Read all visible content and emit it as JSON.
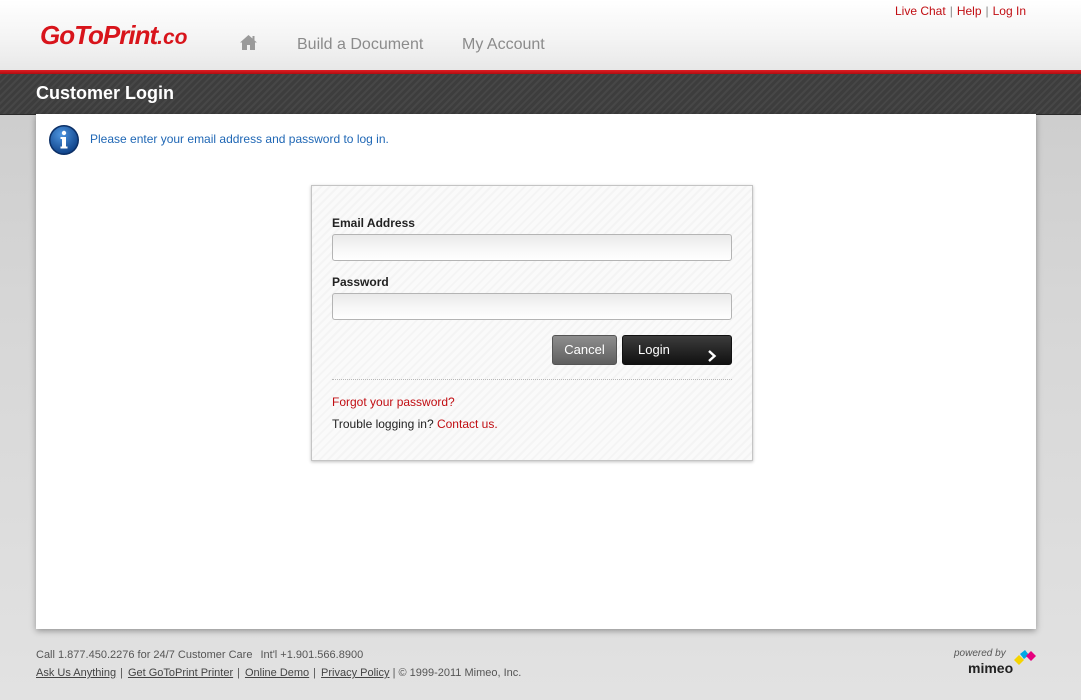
{
  "header": {
    "logo": {
      "main": "GoToPrint",
      "tld": ".co"
    },
    "home_icon": "home-icon",
    "nav": [
      {
        "label": "Build a Document"
      },
      {
        "label": "My Account"
      }
    ],
    "util_links": [
      {
        "label": "Live Chat"
      },
      {
        "label": "Help"
      },
      {
        "label": "Log In"
      }
    ],
    "util_separator": "|"
  },
  "page": {
    "title": "Customer Login",
    "info_icon": "info-icon",
    "info_message": "Please enter your email address and password to log in."
  },
  "login_form": {
    "email_label": "Email Address",
    "email_value": "",
    "password_label": "Password",
    "password_value": "",
    "cancel_label": "Cancel",
    "login_label": "Login",
    "login_icon": "chevron-right-icon",
    "forgot_password": "Forgot your password?",
    "trouble_text": "Trouble logging in?",
    "contact_link": "Contact us."
  },
  "footer": {
    "call_text": "Call 1.877.450.2276 for 24/7 Customer Care",
    "intl_text": "Int'l +1.901.566.8900",
    "links": [
      {
        "label": "Ask Us Anything"
      },
      {
        "label": "Get GoToPrint Printer"
      },
      {
        "label": "Online Demo"
      },
      {
        "label": "Privacy Policy"
      }
    ],
    "separator": "|",
    "copyright": "| © 1999-2011 Mimeo, Inc.",
    "powered_by": "powered by",
    "mimeo": "mimeo"
  },
  "colors": {
    "brand_red": "#d8141b",
    "link_red": "#c10d12",
    "info_blue": "#1f67b5",
    "title_bar": "#3d3d3d"
  }
}
